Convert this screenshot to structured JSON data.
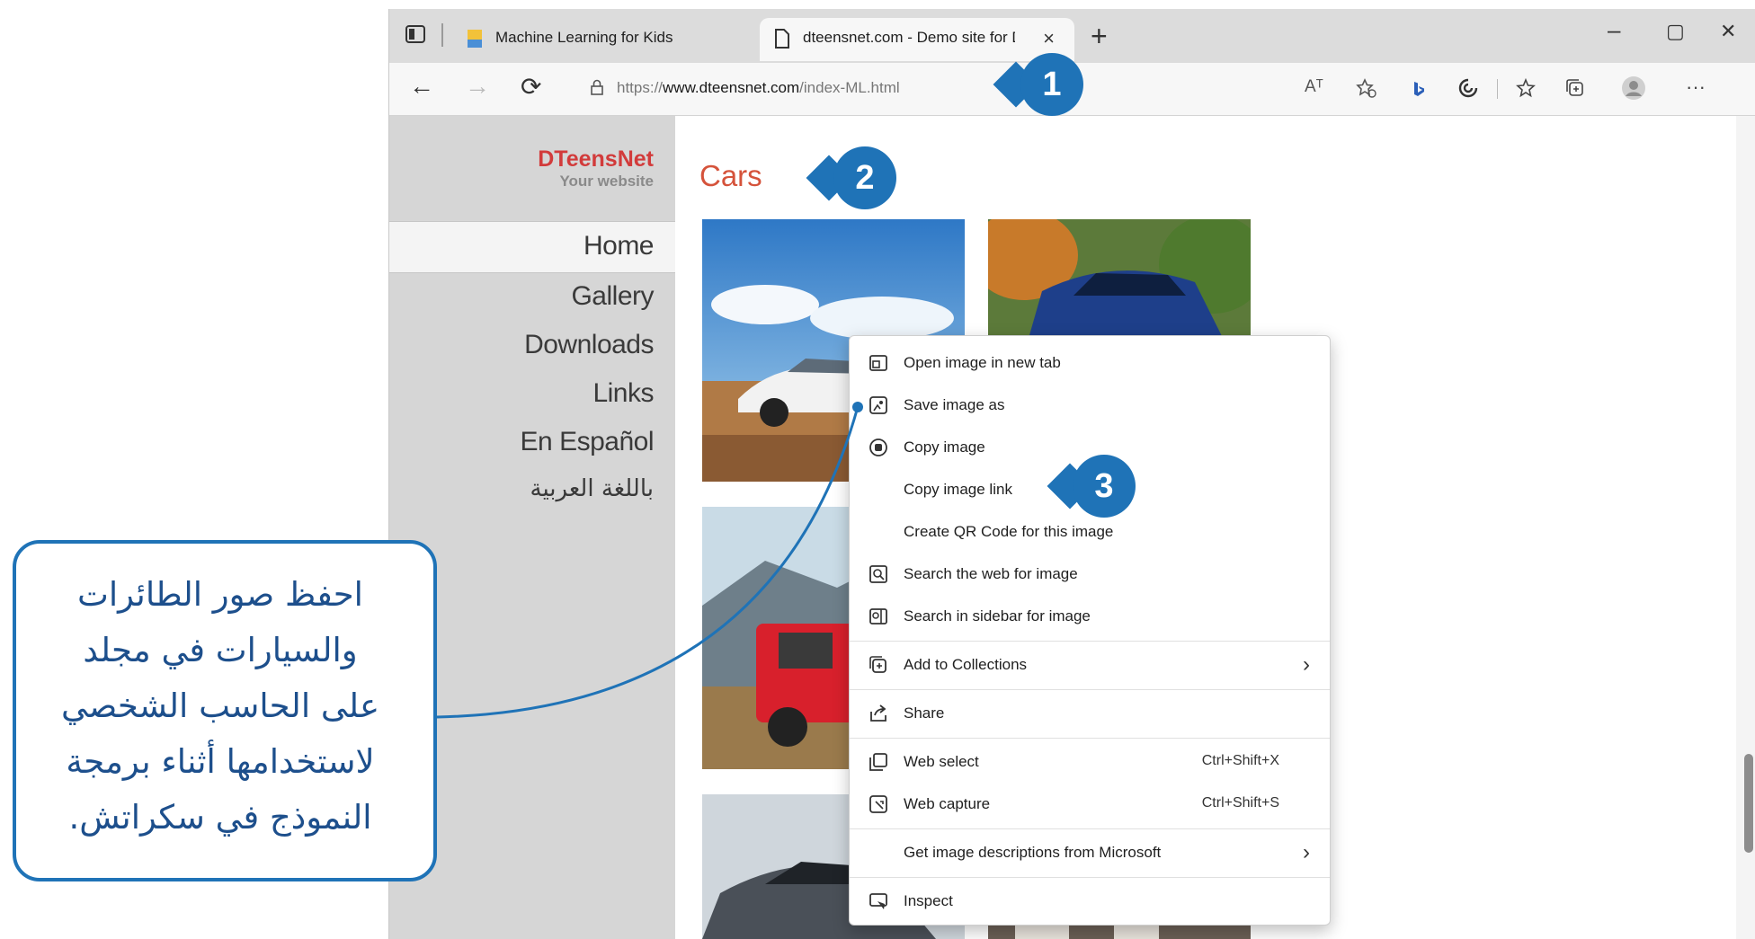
{
  "browser": {
    "tabs": [
      {
        "title": "Machine Learning for Kids",
        "close": "×"
      },
      {
        "title": "dteensnet.com - Demo site for D",
        "close": "×"
      }
    ],
    "new_tab": "+",
    "window_controls": {
      "minimize": "–",
      "maximize": "▢",
      "close": "✕"
    },
    "nav": {
      "back": "←",
      "forward": "→",
      "refresh": "⟳"
    },
    "url": {
      "prefix": "https://",
      "host": "www.dteensnet.com",
      "path": "/index-ML.html"
    },
    "toolbar_icons": [
      "read-aloud-icon",
      "favorites-add-icon",
      "bing-icon",
      "copilot-icon",
      "favorites-icon",
      "collections-icon",
      "profile-icon",
      "more-icon"
    ],
    "toolbar_read_aloud": "Aᵀ",
    "toolbar_more": "···"
  },
  "site": {
    "brand_name": "DTeensNet",
    "brand_tagline": "Your website",
    "nav": [
      "Home",
      "Gallery",
      "Downloads",
      "Links",
      "En Español",
      "باللغة العربية"
    ],
    "page_title": "Cars"
  },
  "context_menu": [
    {
      "label": "Open image in new tab",
      "icon": "new-tab-icon"
    },
    {
      "label": "Save image as",
      "icon": "save-image-icon"
    },
    {
      "label": "Copy image",
      "icon": "copy-image-icon"
    },
    {
      "label": "Copy image link",
      "icon": ""
    },
    {
      "label": "Create QR Code for this image",
      "icon": ""
    },
    {
      "label": "Search the web for image",
      "icon": "search-image-icon"
    },
    {
      "label": "Search in sidebar for image",
      "icon": "sidebar-search-icon"
    },
    {
      "label": "Add to Collections",
      "icon": "collections-icon",
      "submenu": "›"
    },
    {
      "label": "Share",
      "icon": "share-icon"
    },
    {
      "label": "Web select",
      "icon": "web-select-icon",
      "shortcut": "Ctrl+Shift+X"
    },
    {
      "label": "Web capture",
      "icon": "web-capture-icon",
      "shortcut": "Ctrl+Shift+S"
    },
    {
      "label": "Get image descriptions from Microsoft",
      "icon": "",
      "submenu": "›"
    },
    {
      "label": "Inspect",
      "icon": "inspect-icon"
    }
  ],
  "badges": [
    "1",
    "2",
    "3"
  ],
  "callout": {
    "lines": [
      "احفظ صور الطائرات",
      "والسيارات في مجلد",
      "على الحاسب الشخصي",
      "لاستخدامها أثناء برمجة",
      "النموذج في سكراتش."
    ]
  },
  "colors": {
    "accent": "#1f73b7",
    "brand": "#d23b3b",
    "title": "#d5533b"
  }
}
